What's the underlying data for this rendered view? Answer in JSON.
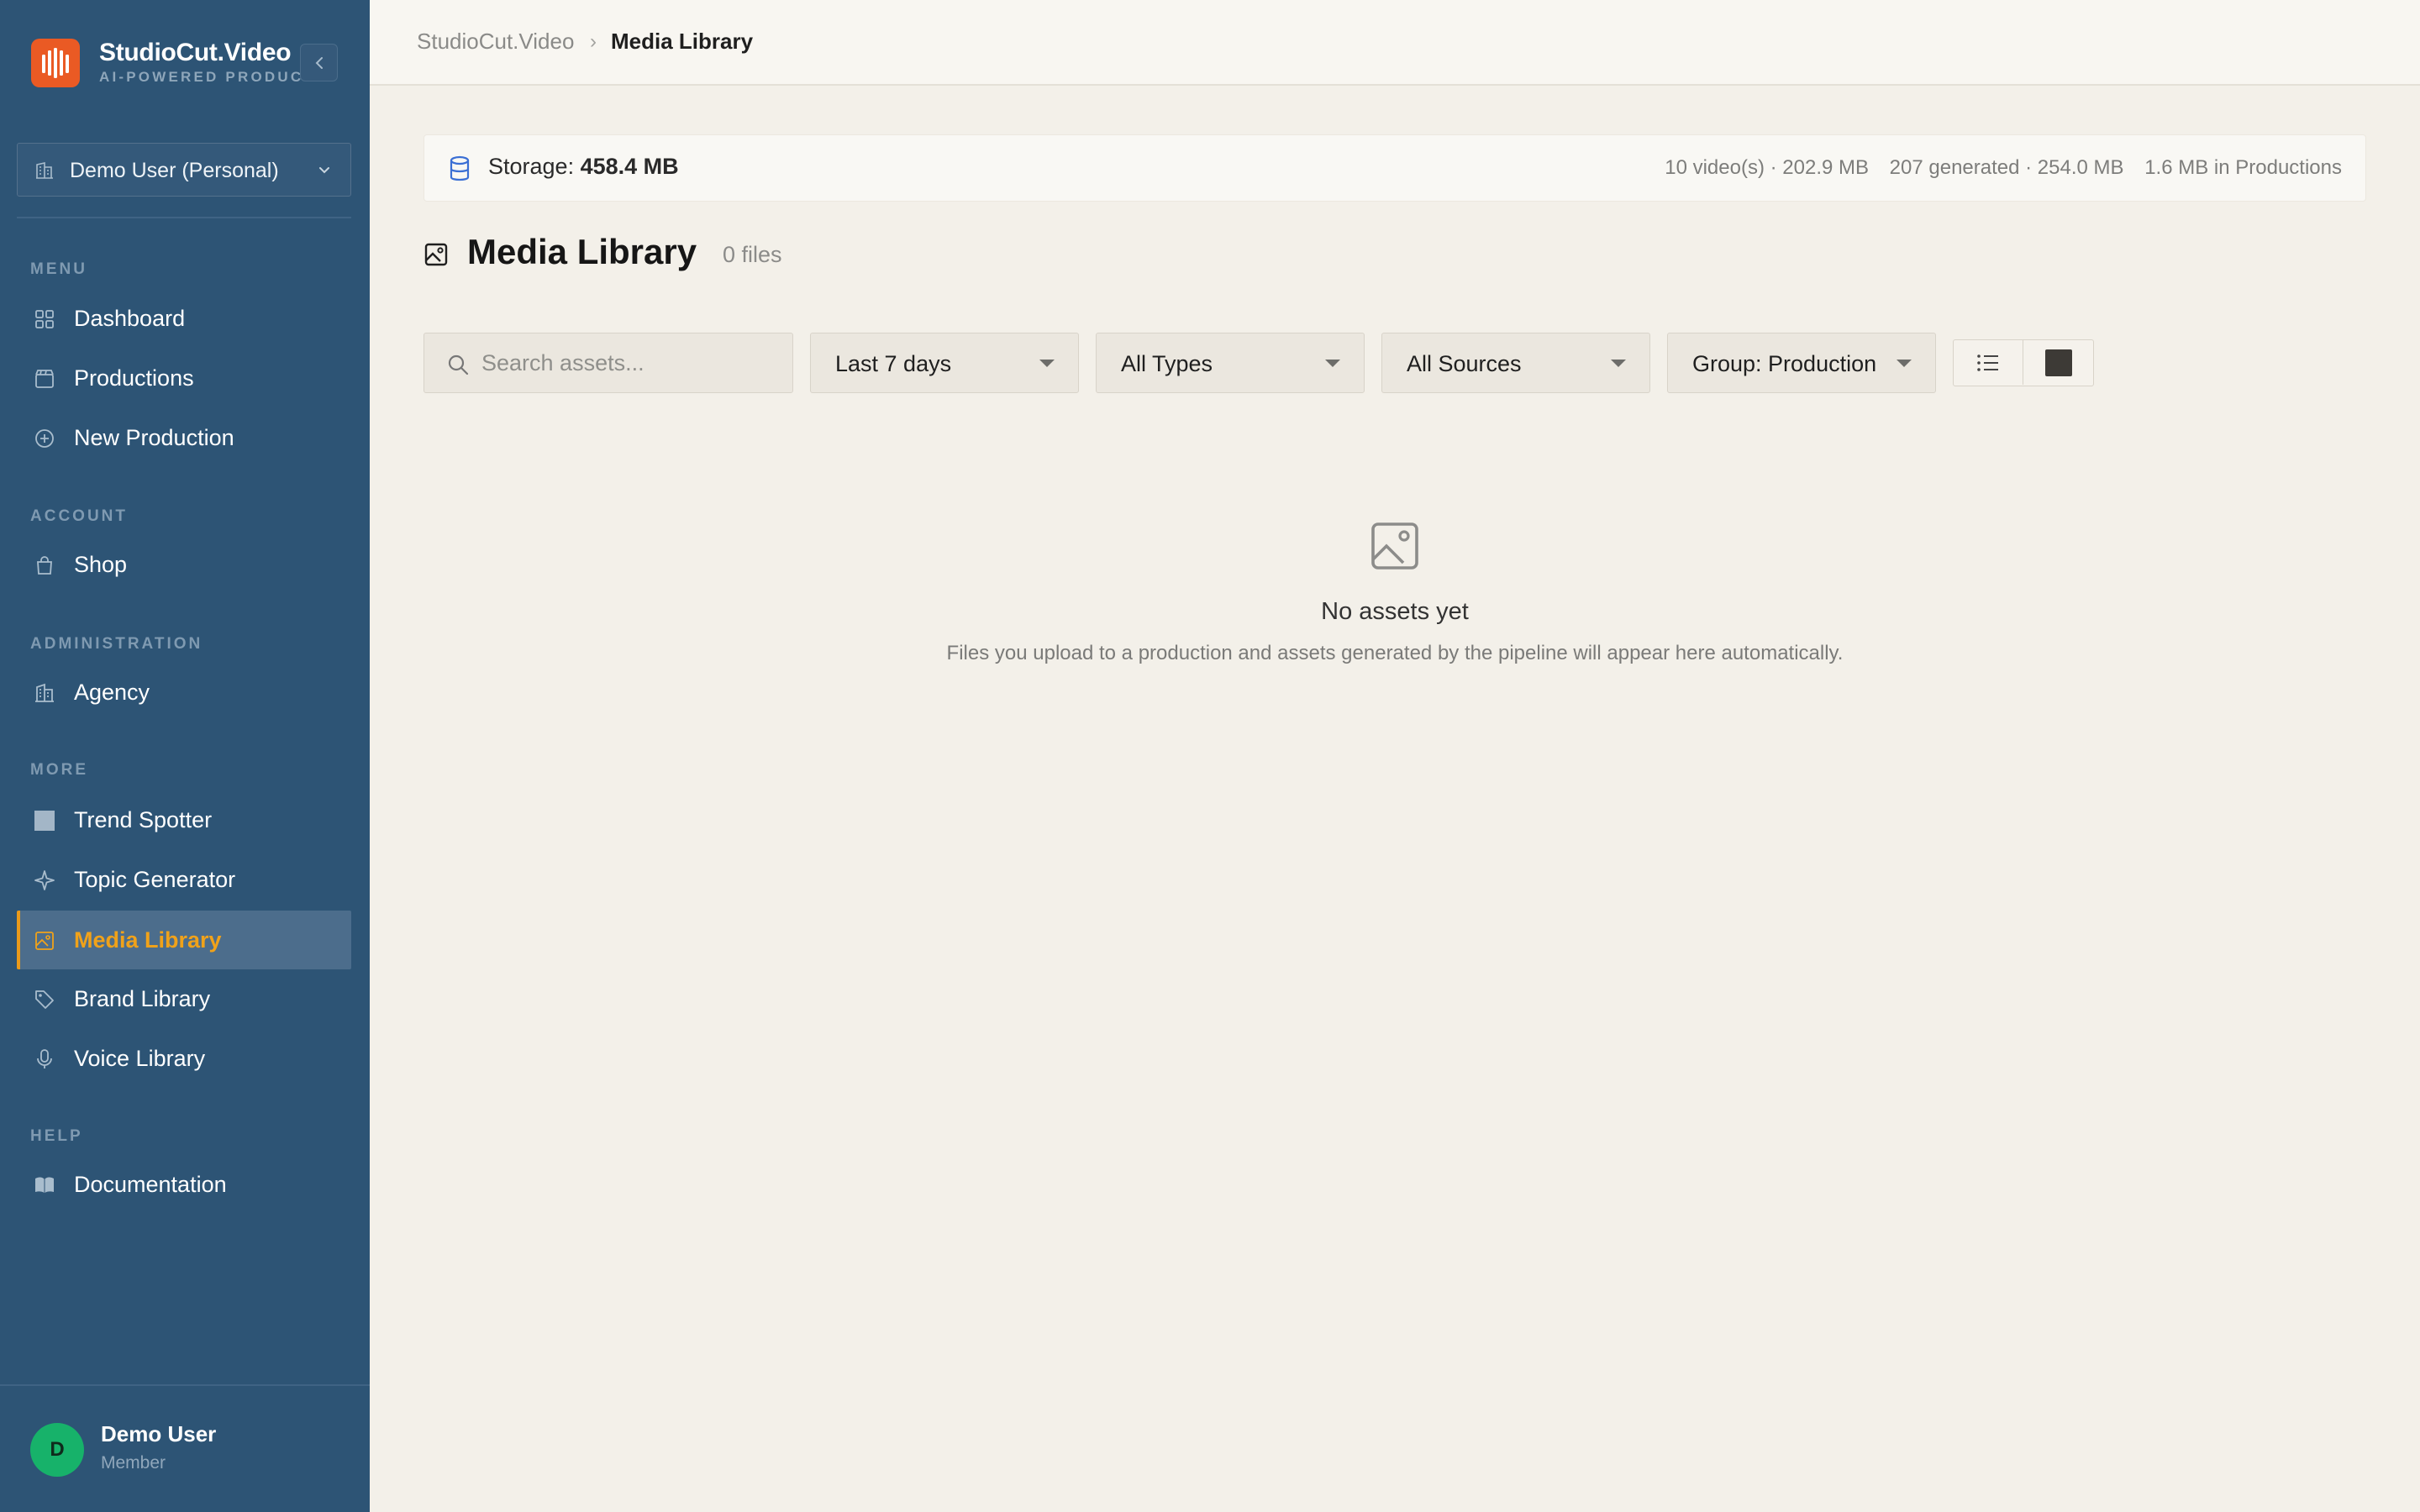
{
  "brand": {
    "title": "StudioCut.Video",
    "subtitle": "AI-POWERED PRODUCTION",
    "accent": "#ea5a24"
  },
  "workspace": {
    "label": "Demo User (Personal)"
  },
  "sidebar": {
    "sections": {
      "menu": "MENU",
      "account": "ACCOUNT",
      "administration": "ADMINISTRATION",
      "more": "MORE",
      "help": "HELP"
    },
    "items": {
      "dashboard": {
        "label": "Dashboard",
        "icon": "grid-icon"
      },
      "productions": {
        "label": "Productions",
        "icon": "clapperboard-icon"
      },
      "new_production": {
        "label": "New Production",
        "icon": "plus-circle-icon"
      },
      "shop": {
        "label": "Shop",
        "icon": "shopping-bag-icon"
      },
      "agency": {
        "label": "Agency",
        "icon": "building-icon"
      },
      "trend_spotter": {
        "label": "Trend Spotter",
        "icon": "square-icon"
      },
      "topic_generator": {
        "label": "Topic Generator",
        "icon": "sparkle-icon"
      },
      "media_library": {
        "label": "Media Library",
        "icon": "image-icon",
        "active": true
      },
      "brand_library": {
        "label": "Brand Library",
        "icon": "tag-icon"
      },
      "voice_library": {
        "label": "Voice Library",
        "icon": "microphone-icon"
      },
      "documentation": {
        "label": "Documentation",
        "icon": "book-icon"
      }
    },
    "active_color": "#f0a21a"
  },
  "user": {
    "initial": "D",
    "name": "Demo User",
    "role": "Member",
    "avatar_color": "#17b26a"
  },
  "breadcrumb": {
    "root": "StudioCut.Video",
    "separator": "›",
    "current": "Media Library"
  },
  "storage": {
    "label": "Storage:",
    "value": "458.4 MB",
    "videos": "10 video(s) · 202.9 MB",
    "generated": "207 generated · 254.0 MB",
    "productions": "1.6 MB in Productions"
  },
  "page": {
    "title": "Media Library",
    "count": "0 files"
  },
  "filters": {
    "search_placeholder": "Search assets...",
    "date_range": "Last 7 days",
    "types": "All Types",
    "sources": "All Sources",
    "group": "Group: Production"
  },
  "view": {
    "mode": "grid"
  },
  "empty_state": {
    "title": "No assets yet",
    "description": "Files you upload to a production and assets generated by the pipeline will appear here automatically."
  }
}
